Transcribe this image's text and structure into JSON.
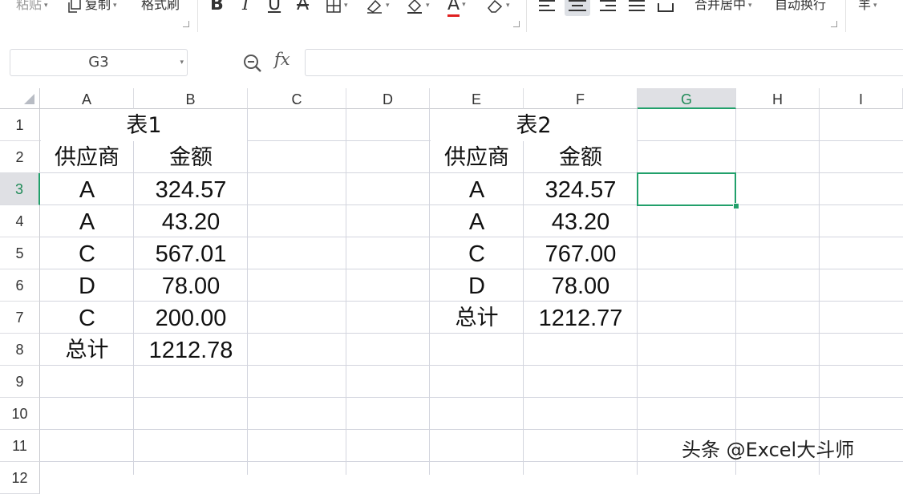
{
  "ribbon": {
    "paste_label": "粘贴",
    "copy_label": "复制",
    "format_painter_label": "格式刷",
    "bold_label": "B",
    "italic_label": "I",
    "underline_label": "U",
    "strike_label": "A",
    "font_color_label": "A",
    "merge_center_label": "合并居中",
    "wrap_text_label": "自动换行",
    "currency_label": "羊",
    "font_color_accent": "#e02020"
  },
  "formula_bar": {
    "name_box": "G3",
    "fx_label": "fx",
    "formula": ""
  },
  "grid": {
    "columns": [
      "A",
      "B",
      "C",
      "D",
      "E",
      "F",
      "G",
      "H",
      "I"
    ],
    "selected_column": "G",
    "rows": [
      "1",
      "2",
      "3",
      "4",
      "5",
      "6",
      "7",
      "8",
      "9",
      "10",
      "11",
      "12"
    ],
    "selected_row": "3",
    "active_cell": "G3",
    "table1": {
      "title": "表1",
      "header_supplier": "供应商",
      "header_amount": "金额",
      "rows": [
        {
          "supplier": "A",
          "amount": "324.57"
        },
        {
          "supplier": "A",
          "amount": "43.20"
        },
        {
          "supplier": "C",
          "amount": "567.01"
        },
        {
          "supplier": "D",
          "amount": "78.00"
        },
        {
          "supplier": "C",
          "amount": "200.00"
        }
      ],
      "total_label": "总计",
      "total_value": "1212.78"
    },
    "table2": {
      "title": "表2",
      "header_supplier": "供应商",
      "header_amount": "金额",
      "rows": [
        {
          "supplier": "A",
          "amount": "324.57"
        },
        {
          "supplier": "A",
          "amount": "43.20"
        },
        {
          "supplier": "C",
          "amount": "767.00"
        },
        {
          "supplier": "D",
          "amount": "78.00"
        }
      ],
      "total_label": "总计",
      "total_value": "1212.77"
    }
  },
  "watermark": "头条 @Excel大斗师",
  "colors": {
    "selection_green": "#22a06b",
    "header_selected_bg": "#dfe0e4",
    "grid_line": "#d3d5de"
  }
}
